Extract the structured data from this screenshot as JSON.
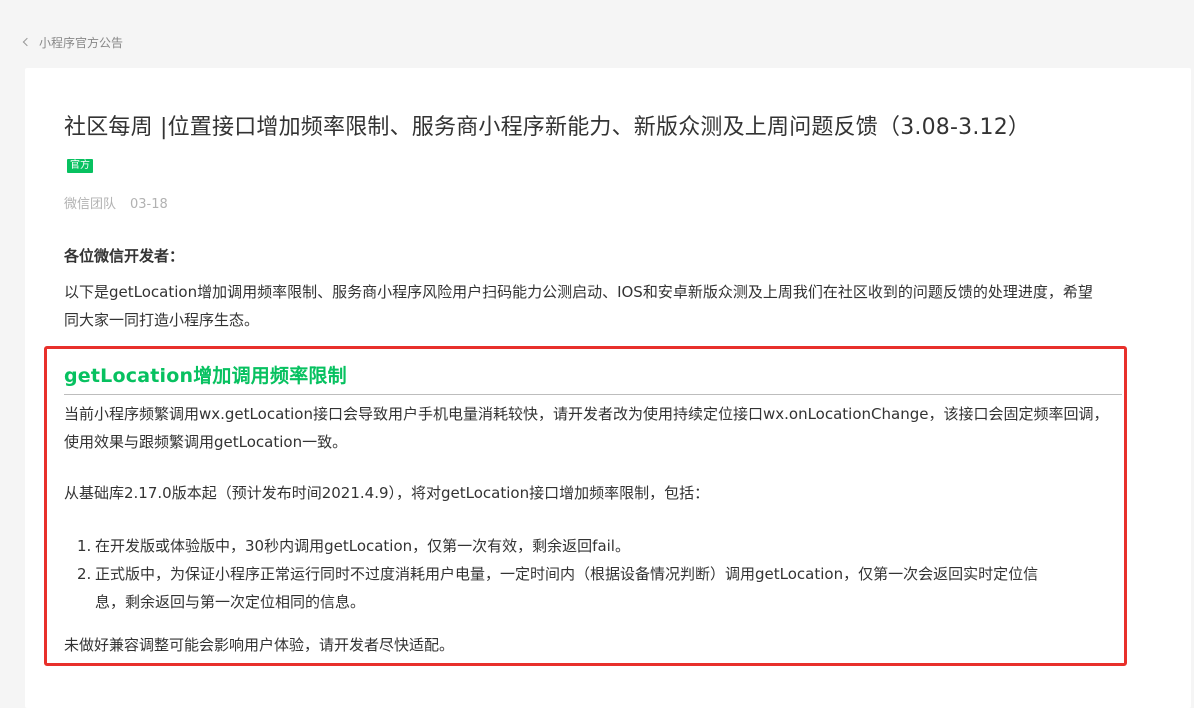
{
  "breadcrumb": {
    "label": "小程序官方公告"
  },
  "article": {
    "title": "社区每周 |位置接口增加频率限制、服务商小程序新能力、新版众测及上周问题反馈（3.08-3.12）",
    "badge": "官方",
    "author": "微信团队",
    "date": "03-18",
    "greeting": "各位微信开发者：",
    "intro": "以下是getLocation增加调用频率限制、服务商小程序风险用户扫码能力公测启动、IOS和安卓新版众测及上周我们在社区收到的问题反馈的处理进度，希望同大家一同打造小程序生态。"
  },
  "section": {
    "title": "getLocation增加调用频率限制",
    "p1": "当前小程序频繁调用wx.getLocation接口会导致用户手机电量消耗较快，请开发者改为使用持续定位接口wx.onLocationChange，该接口会固定频率回调，使用效果与跟频繁调用getLocation一致。",
    "p2": "从基础库2.17.0版本起（预计发布时间2021.4.9），将对getLocation接口增加频率限制，包括：",
    "items": [
      {
        "num": "1.",
        "text": "在开发版或体验版中，30秒内调用getLocation，仅第一次有效，剩余返回fail。"
      },
      {
        "num": "2.",
        "text": "正式版中，为保证小程序正常运行同时不过度消耗用户电量，一定时间内（根据设备情况判断）调用getLocation，仅第一次会返回实时定位信息，剩余返回与第一次定位相同的信息。"
      }
    ],
    "p3": "未做好兼容调整可能会影响用户体验，请开发者尽快适配。"
  },
  "colors": {
    "accent_green": "#07c160",
    "highlight_red": "#e8302b"
  }
}
